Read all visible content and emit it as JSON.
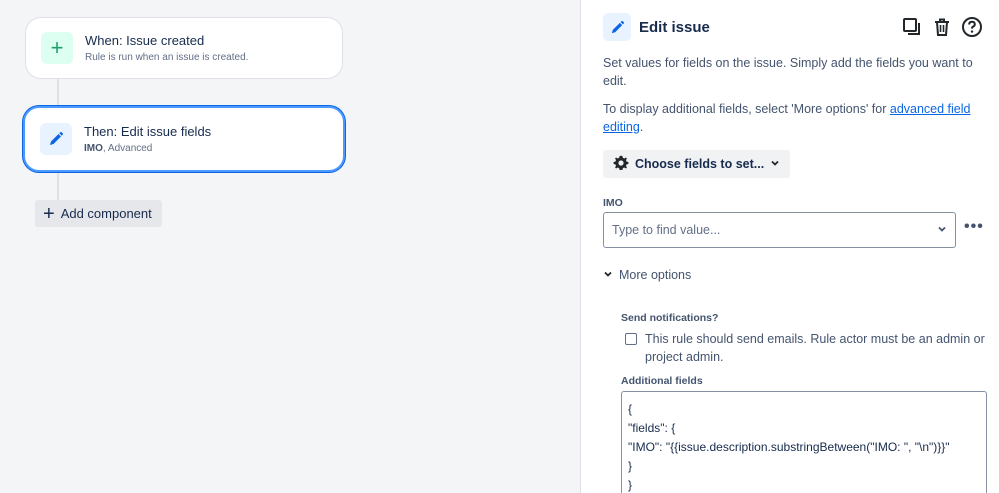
{
  "canvas": {
    "trigger": {
      "title": "When: Issue created",
      "subtitle": "Rule is run when an issue is created.",
      "icon": "plus-icon"
    },
    "action": {
      "title": "Then: Edit issue fields",
      "subtitle_strong": "IMO",
      "subtitle_rest": ", Advanced",
      "icon": "pencil-icon"
    },
    "add_component_label": "Add component"
  },
  "panel": {
    "title": "Edit issue",
    "description": "Set values for fields on the issue. Simply add the fields you want to edit.",
    "more_info_prefix": "To display additional fields, select 'More options' for ",
    "more_info_link": "advanced field editing",
    "more_info_suffix": ".",
    "choose_fields_label": "Choose fields to set...",
    "imo_label": "IMO",
    "imo_placeholder": "Type to find value...",
    "more_options_label": "More options",
    "send_notifications_label": "Send notifications?",
    "send_notifications_text": "This rule should send emails. Rule actor must be an admin or project admin.",
    "additional_fields_label": "Additional fields",
    "additional_fields_value": "{\n\"fields\": {\n\"IMO\": \"{{issue.description.substringBetween(\"IMO: \", \"\\n\")}}\"\n}\n}"
  },
  "colors": {
    "accent": "#0c66e4",
    "trigger_green": "#22a06b",
    "selected_border": "#4c9aff"
  }
}
